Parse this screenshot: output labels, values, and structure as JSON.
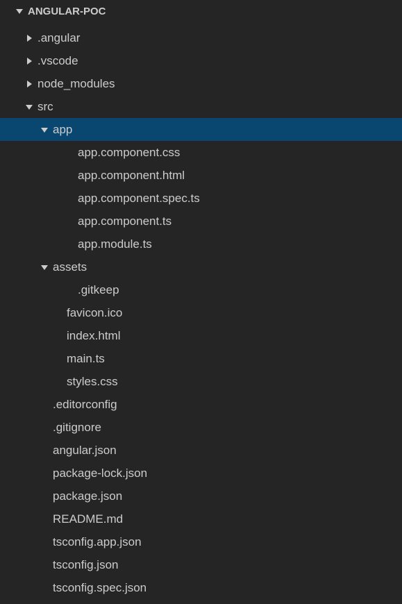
{
  "rootName": "ANGULAR-POC",
  "tree": [
    {
      "label": ".angular",
      "depth": 1,
      "kind": "folder",
      "expanded": false,
      "selected": false
    },
    {
      "label": ".vscode",
      "depth": 1,
      "kind": "folder",
      "expanded": false,
      "selected": false
    },
    {
      "label": "node_modules",
      "depth": 1,
      "kind": "folder",
      "expanded": false,
      "selected": false
    },
    {
      "label": "src",
      "depth": 1,
      "kind": "folder",
      "expanded": true,
      "selected": false
    },
    {
      "label": "app",
      "depth": 2,
      "kind": "folder",
      "expanded": true,
      "selected": true
    },
    {
      "label": "app.component.css",
      "depth": 4,
      "kind": "file",
      "selected": false
    },
    {
      "label": "app.component.html",
      "depth": 4,
      "kind": "file",
      "selected": false
    },
    {
      "label": "app.component.spec.ts",
      "depth": 4,
      "kind": "file",
      "selected": false
    },
    {
      "label": "app.component.ts",
      "depth": 4,
      "kind": "file",
      "selected": false
    },
    {
      "label": "app.module.ts",
      "depth": 4,
      "kind": "file",
      "selected": false
    },
    {
      "label": "assets",
      "depth": 2,
      "kind": "folder",
      "expanded": true,
      "selected": false
    },
    {
      "label": ".gitkeep",
      "depth": 4,
      "kind": "file",
      "selected": false
    },
    {
      "label": "favicon.ico",
      "depth": 3,
      "kind": "file",
      "selected": false
    },
    {
      "label": "index.html",
      "depth": 3,
      "kind": "file",
      "selected": false
    },
    {
      "label": "main.ts",
      "depth": 3,
      "kind": "file",
      "selected": false
    },
    {
      "label": "styles.css",
      "depth": 3,
      "kind": "file",
      "selected": false
    },
    {
      "label": ".editorconfig",
      "depth": 2,
      "kind": "file",
      "selected": false
    },
    {
      "label": ".gitignore",
      "depth": 2,
      "kind": "file",
      "selected": false
    },
    {
      "label": "angular.json",
      "depth": 2,
      "kind": "file",
      "selected": false
    },
    {
      "label": "package-lock.json",
      "depth": 2,
      "kind": "file",
      "selected": false
    },
    {
      "label": "package.json",
      "depth": 2,
      "kind": "file",
      "selected": false
    },
    {
      "label": "README.md",
      "depth": 2,
      "kind": "file",
      "selected": false
    },
    {
      "label": "tsconfig.app.json",
      "depth": 2,
      "kind": "file",
      "selected": false
    },
    {
      "label": "tsconfig.json",
      "depth": 2,
      "kind": "file",
      "selected": false
    },
    {
      "label": "tsconfig.spec.json",
      "depth": 2,
      "kind": "file",
      "selected": false
    }
  ]
}
